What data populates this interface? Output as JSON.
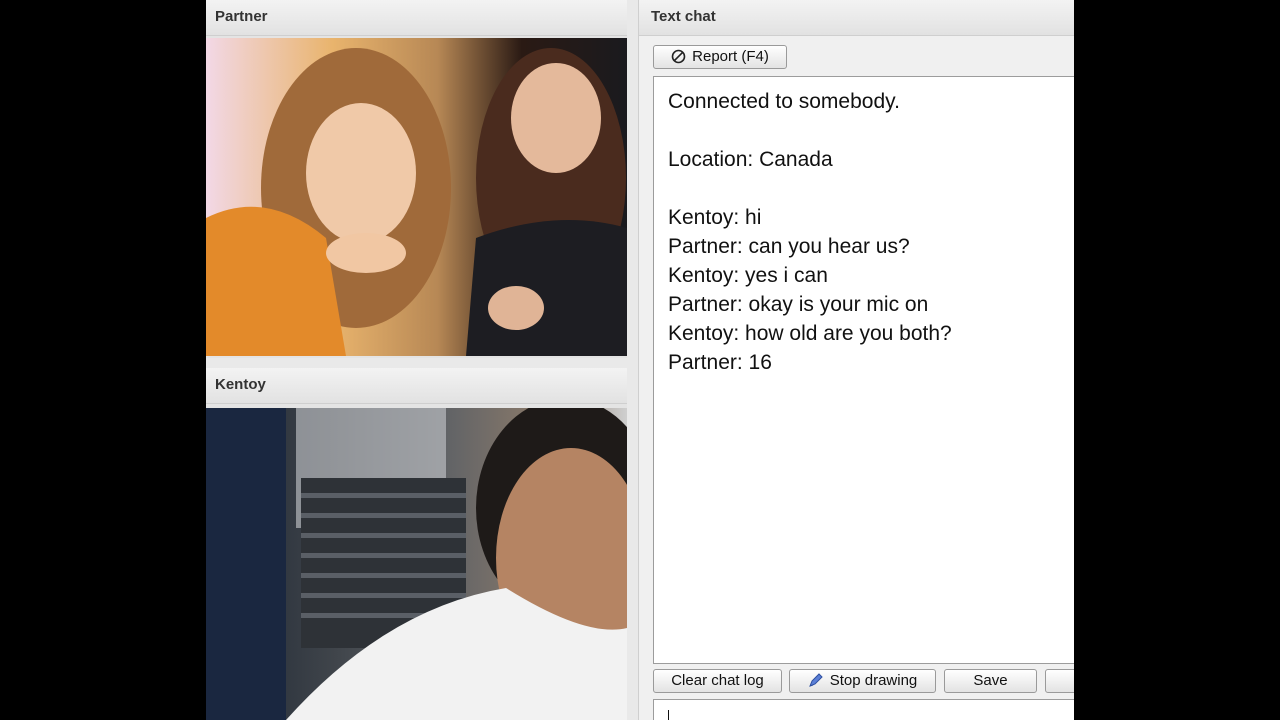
{
  "panels": {
    "partner": {
      "title": "Partner"
    },
    "self": {
      "title": "Kentoy"
    }
  },
  "chat": {
    "title": "Text chat",
    "report_button": "Report (F4)",
    "messages": [
      "Connected to somebody.",
      "",
      "Location: Canada",
      "",
      "Kentoy: hi",
      "Partner: can you hear us?",
      "Kentoy: yes i can",
      "Partner: okay is your mic on",
      "Kentoy: how old are you both?",
      "Partner: 16"
    ],
    "buttons": {
      "clear": "Clear chat log",
      "stop_drawing": "Stop drawing",
      "save": "Save"
    },
    "input_value": ""
  },
  "colors": {
    "page_background": "#000000",
    "panel_background": "#e9e9e9",
    "log_background": "#ffffff"
  },
  "icons": [
    "forbidden-icon",
    "pencil-draw-icon"
  ]
}
